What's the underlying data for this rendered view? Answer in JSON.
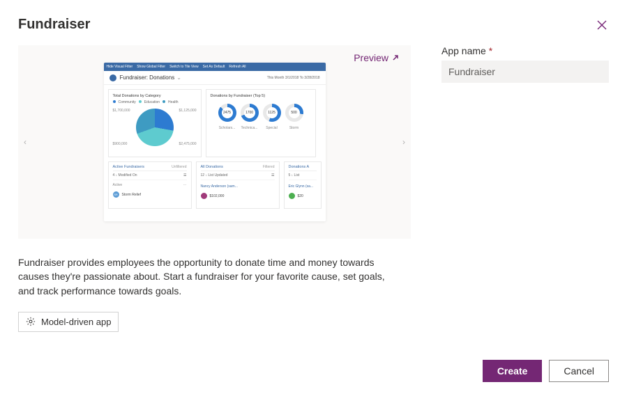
{
  "title": "Fundraiser",
  "preview_label": "Preview",
  "form": {
    "app_name_label": "App name",
    "app_name_value": "Fundraiser"
  },
  "description": "Fundraiser provides employees the opportunity to donate time and money towards causes they're passionate about. Start a fundraiser for your favorite cause, set goals, and track performance towards goals.",
  "badge": "Model-driven app",
  "buttons": {
    "create": "Create",
    "cancel": "Cancel"
  },
  "thumb": {
    "toolbar": [
      "Hide Visual Filter",
      "Show Global Filter",
      "Switch to Tile View",
      "Set As Default",
      "Refresh All"
    ],
    "header_title": "Fundraiser: Donations",
    "header_date": "This Month 3/1/2018 To 3/28/2018",
    "card_a": {
      "title": "Total Donations by Category",
      "legend": [
        "Community",
        "Education",
        "Health"
      ],
      "labels": [
        "$1,700,000",
        "$1,125,000",
        "$900,000",
        "$2,475,000"
      ]
    },
    "card_b": {
      "title": "Donations by Fundraiser (Top 5)",
      "donuts": [
        {
          "value": "2475",
          "pct": 310,
          "color": "#2d7bd1"
        },
        {
          "value": "1700",
          "pct": 250,
          "color": "#2d7bd1"
        },
        {
          "value": "1125",
          "pct": 200,
          "color": "#2d7bd1"
        },
        {
          "value": "500",
          "pct": 100,
          "color": "#2d7bd1"
        }
      ],
      "labels": [
        "Scholars...",
        "Technica...",
        "Special",
        "Storm"
      ]
    },
    "card_c": {
      "title": "Active Fundraisers",
      "filter": "Unfiltered",
      "sort": "4 ↓  Modified On",
      "section": "Active",
      "row": {
        "avatar": "#5a9bd5",
        "initials": "SR",
        "name": "Storm Relief"
      }
    },
    "card_d": {
      "title": "All Donations",
      "filter": "Filtered",
      "sort": "12 ↓  List Updated",
      "row": {
        "avatar": "#a03a7a",
        "label": "Nancy Anderson (sam...",
        "value": "$102,000"
      }
    },
    "card_e": {
      "title": "Donations A",
      "sort": "5 ↓  List",
      "row": {
        "avatar": "#4caf50",
        "label": "Eric Glynn (sa...",
        "value": "$20"
      }
    }
  },
  "chart_data": [
    {
      "type": "pie",
      "title": "Total Donations by Category",
      "categories": [
        "Community",
        "Education",
        "Health"
      ],
      "values": [
        1700000,
        1125000,
        2475000
      ]
    },
    {
      "type": "bar",
      "title": "Donations by Fundraiser (Top 5)",
      "categories": [
        "Scholars",
        "Technica",
        "Special",
        "Storm"
      ],
      "values": [
        2475,
        1700,
        1125,
        500
      ]
    }
  ]
}
